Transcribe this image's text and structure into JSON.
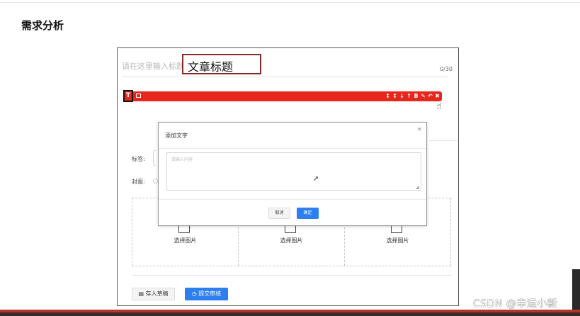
{
  "heading": "需求分析",
  "title_area": {
    "placeholder": "请在这里输入标题",
    "highlight_text": "文章标题",
    "counter": "0/30"
  },
  "toolbar": {
    "color": "#e8271c",
    "text_icon": "T",
    "right_icons": [
      "↕",
      "↕",
      "↓",
      "↑",
      "B",
      "✎",
      "↶",
      "✖"
    ]
  },
  "form": {
    "tags_label": "标签:",
    "cover_label": "封面:"
  },
  "dialog": {
    "title": "添加文字",
    "close": "×",
    "textarea_placeholder": "请输入内容",
    "cancel_label": "取消",
    "confirm_label": "确定"
  },
  "uploads": {
    "items": [
      "选择图片",
      "选择图片",
      "选择图片"
    ]
  },
  "actions": {
    "draft_label": "存入草稿",
    "submit_label": "提交审核"
  },
  "watermark": "CSDN @幸运小新"
}
